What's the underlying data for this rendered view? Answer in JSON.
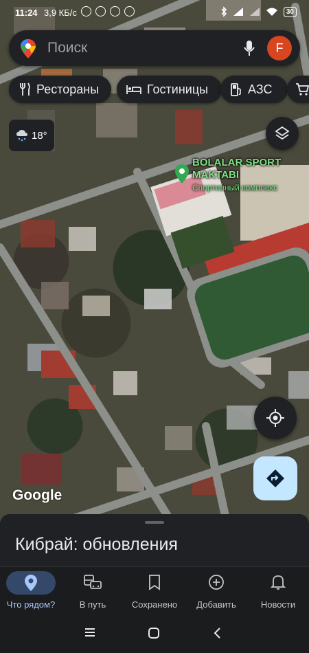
{
  "status_bar": {
    "time": "11:24",
    "speed": "3,9 КБ/с",
    "battery": "30"
  },
  "search": {
    "placeholder": "Поиск",
    "avatar_letter": "F"
  },
  "chips": [
    {
      "label": "Рестораны",
      "icon": "fork-knife-icon"
    },
    {
      "label": "Гостиницы",
      "icon": "bed-icon"
    },
    {
      "label": "АЗС",
      "icon": "gas-station-icon"
    },
    {
      "label": "",
      "icon": "cart-icon"
    }
  ],
  "weather": {
    "temperature": "18°",
    "icon": "rain-cloud-icon"
  },
  "place": {
    "name": "BOLALAR SPORT MAKTABI",
    "type": "Спортивный комплекс"
  },
  "map": {
    "attribution": "Google"
  },
  "sheet": {
    "title": "Кибрай: обновления"
  },
  "bottom_nav": [
    {
      "label": "Что рядом?",
      "icon": "location-pin-icon",
      "active": true
    },
    {
      "label": "В путь",
      "icon": "commute-icon",
      "active": false
    },
    {
      "label": "Сохранено",
      "icon": "bookmark-icon",
      "active": false
    },
    {
      "label": "Добавить",
      "icon": "add-circle-icon",
      "active": false
    },
    {
      "label": "Новости",
      "icon": "bell-icon",
      "active": false
    }
  ],
  "colors": {
    "active_accent": "#a8c7fa",
    "avatar": "#d8461f",
    "place_label": "#7ee084",
    "directions_button": "#c2e7ff"
  }
}
